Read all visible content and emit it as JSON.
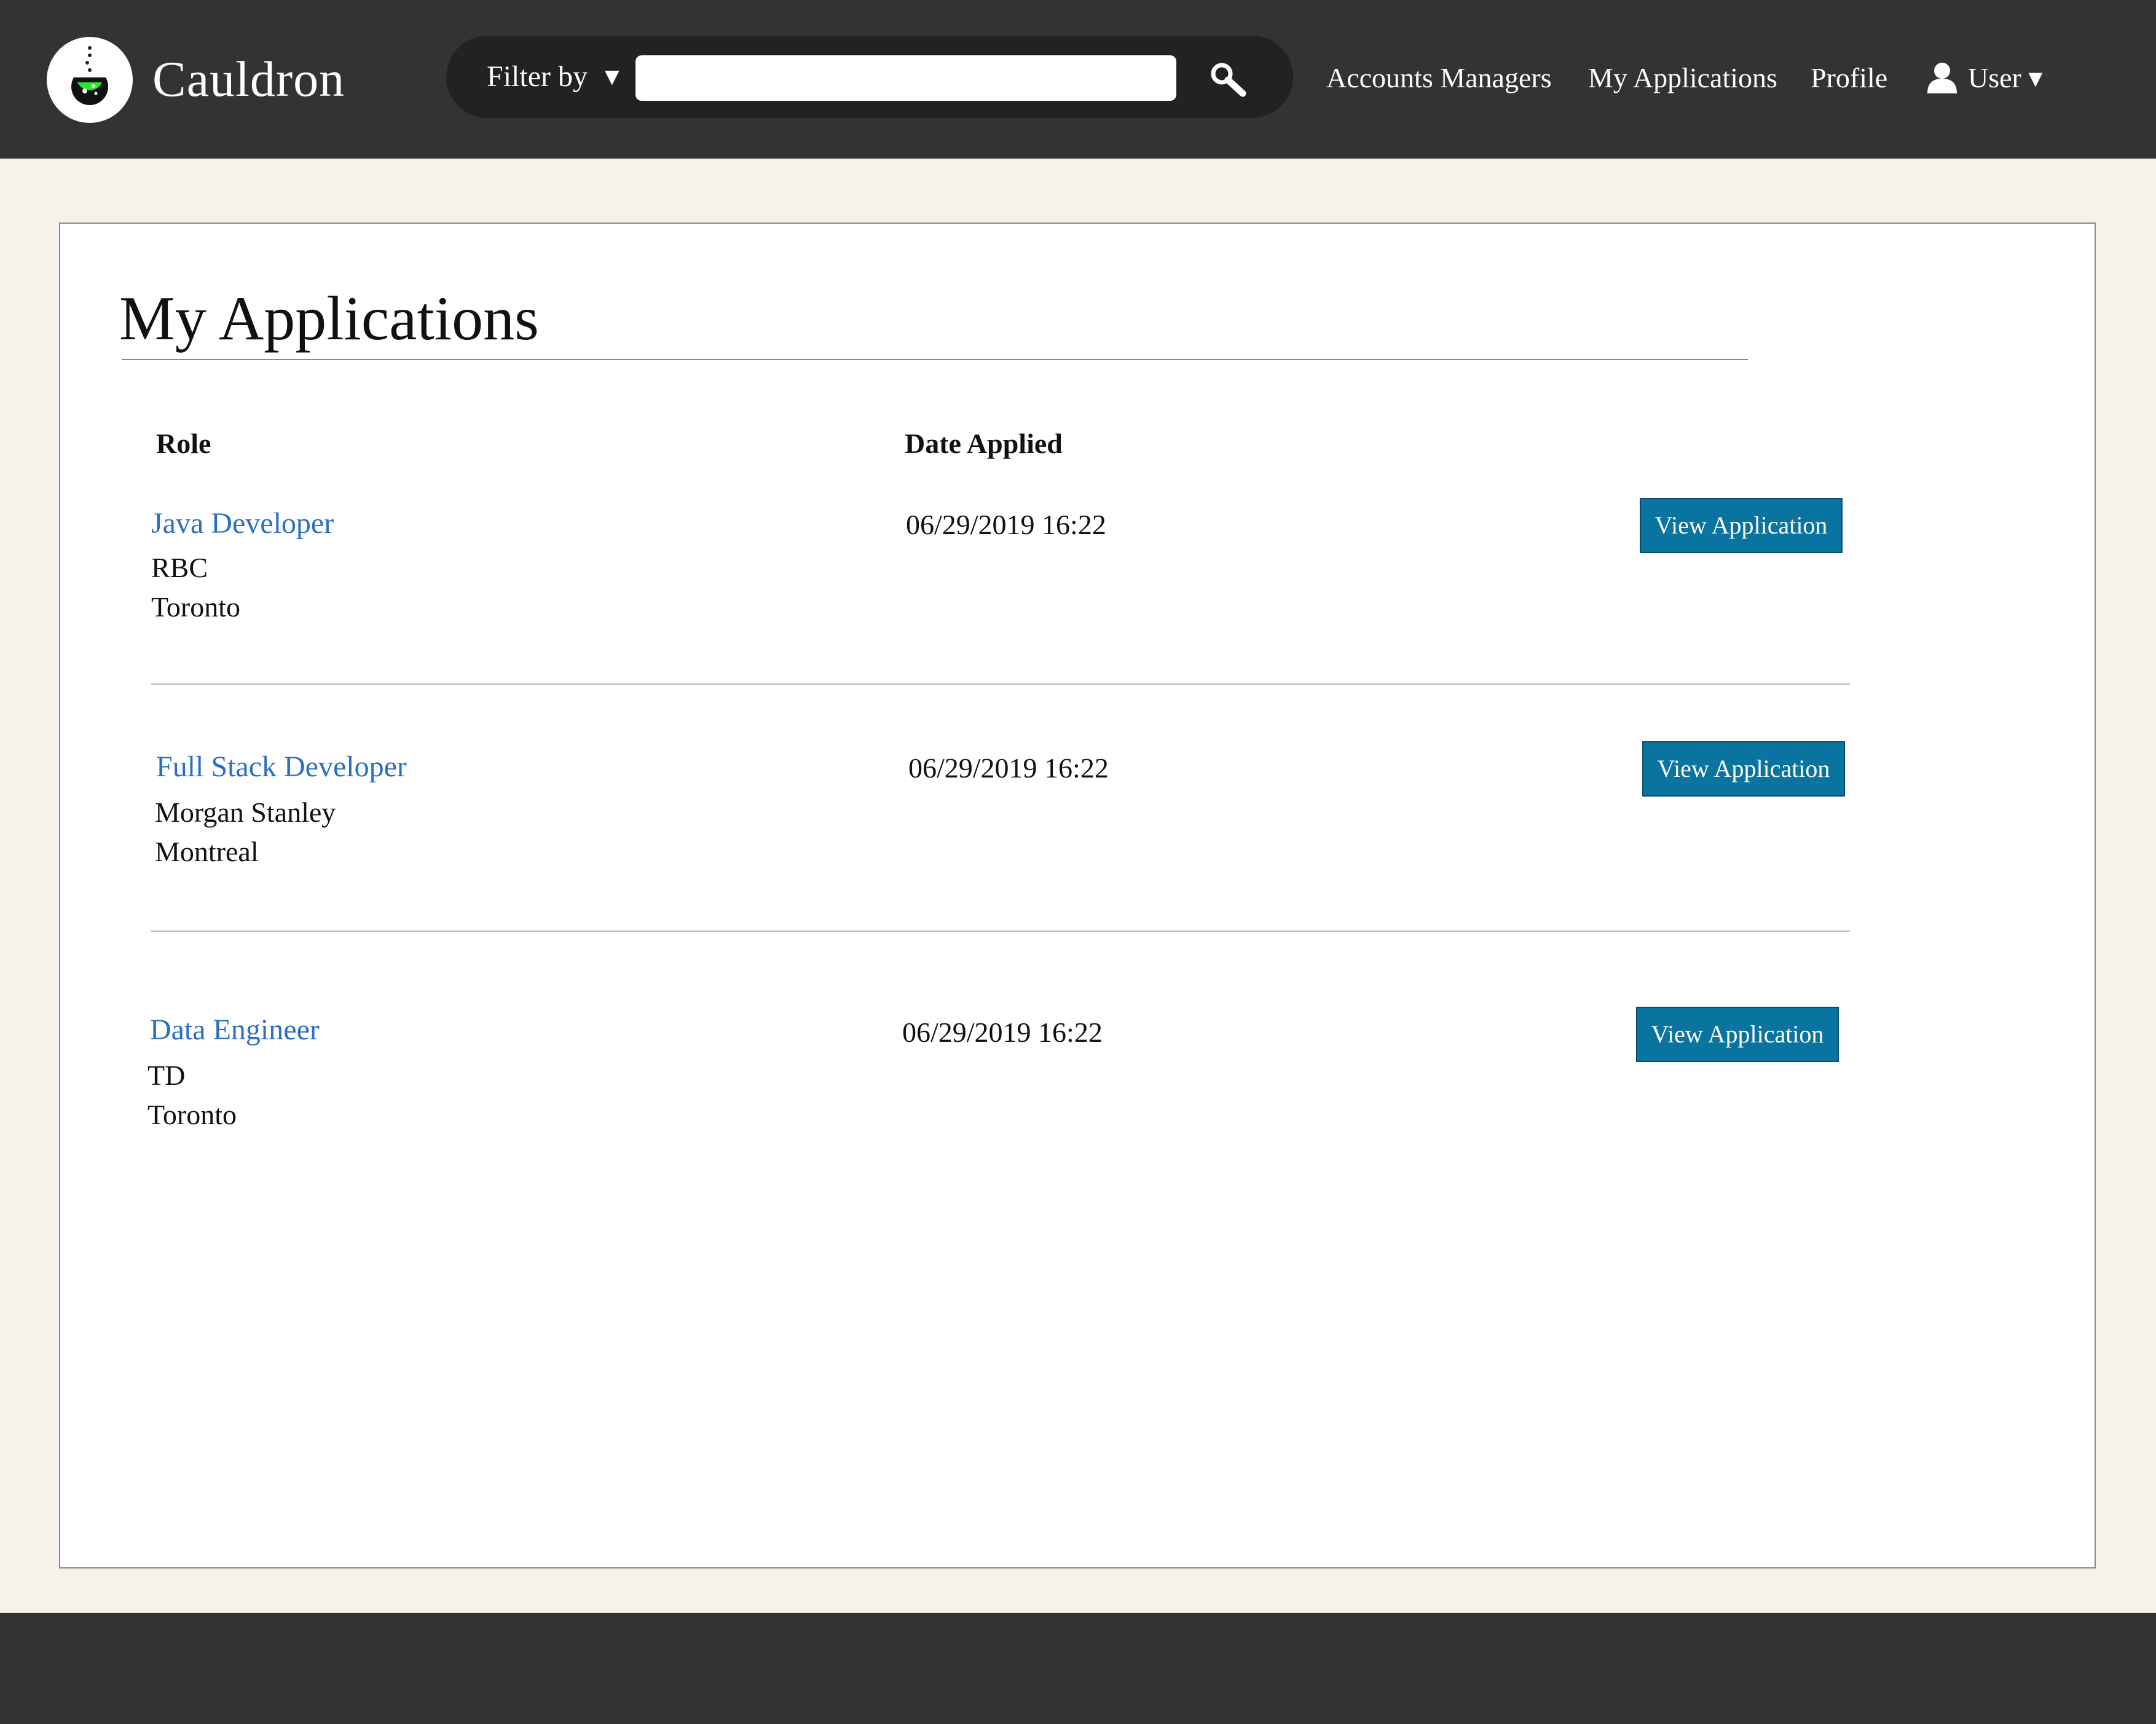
{
  "header": {
    "brand": "Cauldron",
    "logo_icon": "cauldron-flask-icon",
    "filter": {
      "label": "Filter by",
      "caret": "▼",
      "input_value": "",
      "input_placeholder": "",
      "search_icon": "search-icon"
    },
    "nav": {
      "accounts_managers": "Accounts Managers",
      "my_applications": "My Applications",
      "profile": "Profile",
      "user": "User ▾",
      "user_icon": "user-icon"
    }
  },
  "page": {
    "title": "My Applications",
    "columns": {
      "role": "Role",
      "date_applied": "Date Applied"
    },
    "applications": [
      {
        "role": "Java Developer",
        "company": "RBC",
        "city": "Toronto",
        "date": "06/29/2019 16:22",
        "action": "View Application"
      },
      {
        "role": "Full Stack Developer",
        "company": "Morgan Stanley",
        "city": "Montreal",
        "date": "06/29/2019 16:22",
        "action": "View Application"
      },
      {
        "role": "Data Engineer",
        "company": "TD",
        "city": "Toronto",
        "date": "06/29/2019 16:22",
        "action": "View Application"
      }
    ]
  },
  "colors": {
    "topbar": "#333333",
    "background": "#f5f3e9",
    "link": "#2a6fc1",
    "button": "#0a74a0"
  }
}
